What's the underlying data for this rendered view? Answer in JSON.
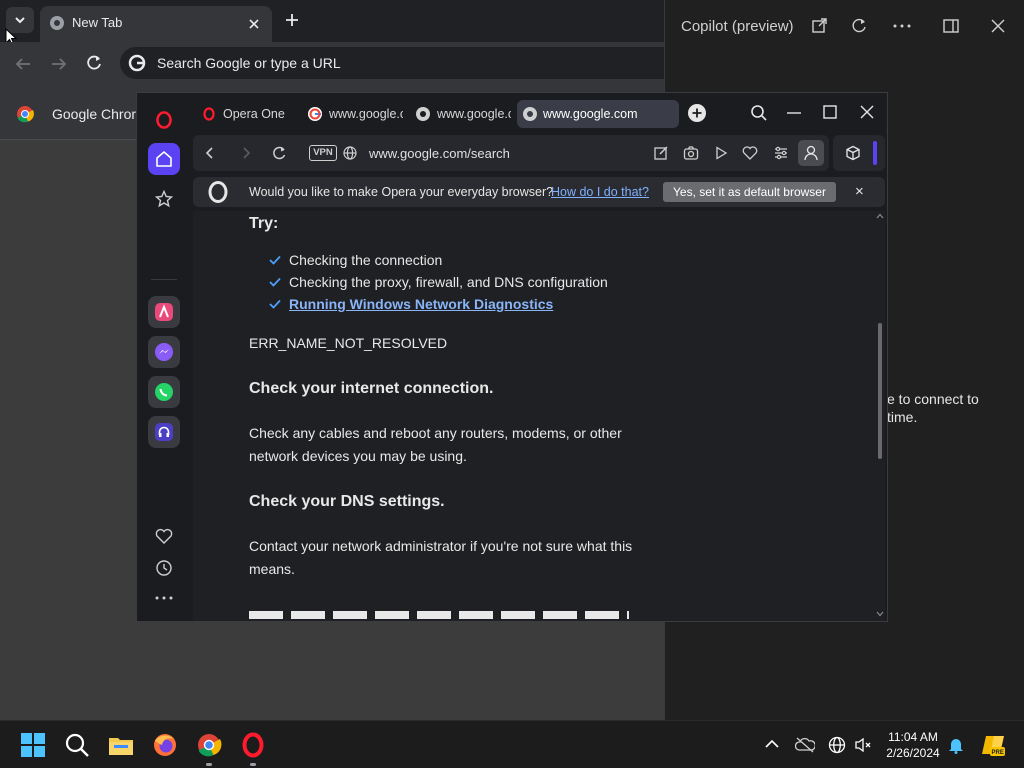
{
  "chrome": {
    "tab_title": "New Tab",
    "omnibox_placeholder": "Search Google or type a URL",
    "bookmark_label": "Google Chrom"
  },
  "copilot": {
    "title": "Copilot (preview)",
    "partial_text_1": "e to connect to",
    "partial_text_2": "time."
  },
  "opera": {
    "tabs": [
      {
        "label": "Opera One"
      },
      {
        "label": "www.google.co"
      },
      {
        "label": "www.google.co"
      },
      {
        "label": "www.google.com"
      }
    ],
    "address": "www.google.com/search",
    "vpn_label": "VPN",
    "banner": {
      "question": "Would you like to make Opera your everyday browser?",
      "link": "How do I do that?",
      "button": "Yes, set it as default browser",
      "close": "×"
    },
    "content": {
      "try_heading": "Try:",
      "checks": [
        "Checking the connection",
        "Checking the proxy, firewall, and DNS configuration",
        "Running Windows Network Diagnostics"
      ],
      "error_code": "ERR_NAME_NOT_RESOLVED",
      "h1": "Check your internet connection.",
      "p1_line1": "Check any cables and reboot any routers, modems, or other",
      "p1_line2": "network devices you may be using.",
      "h2": "Check your DNS settings.",
      "p2_line1": "Contact your network administrator if you're not sure what this",
      "p2_line2": "means."
    }
  },
  "taskbar": {
    "time": "11:04 AM",
    "date": "2/26/2024"
  }
}
